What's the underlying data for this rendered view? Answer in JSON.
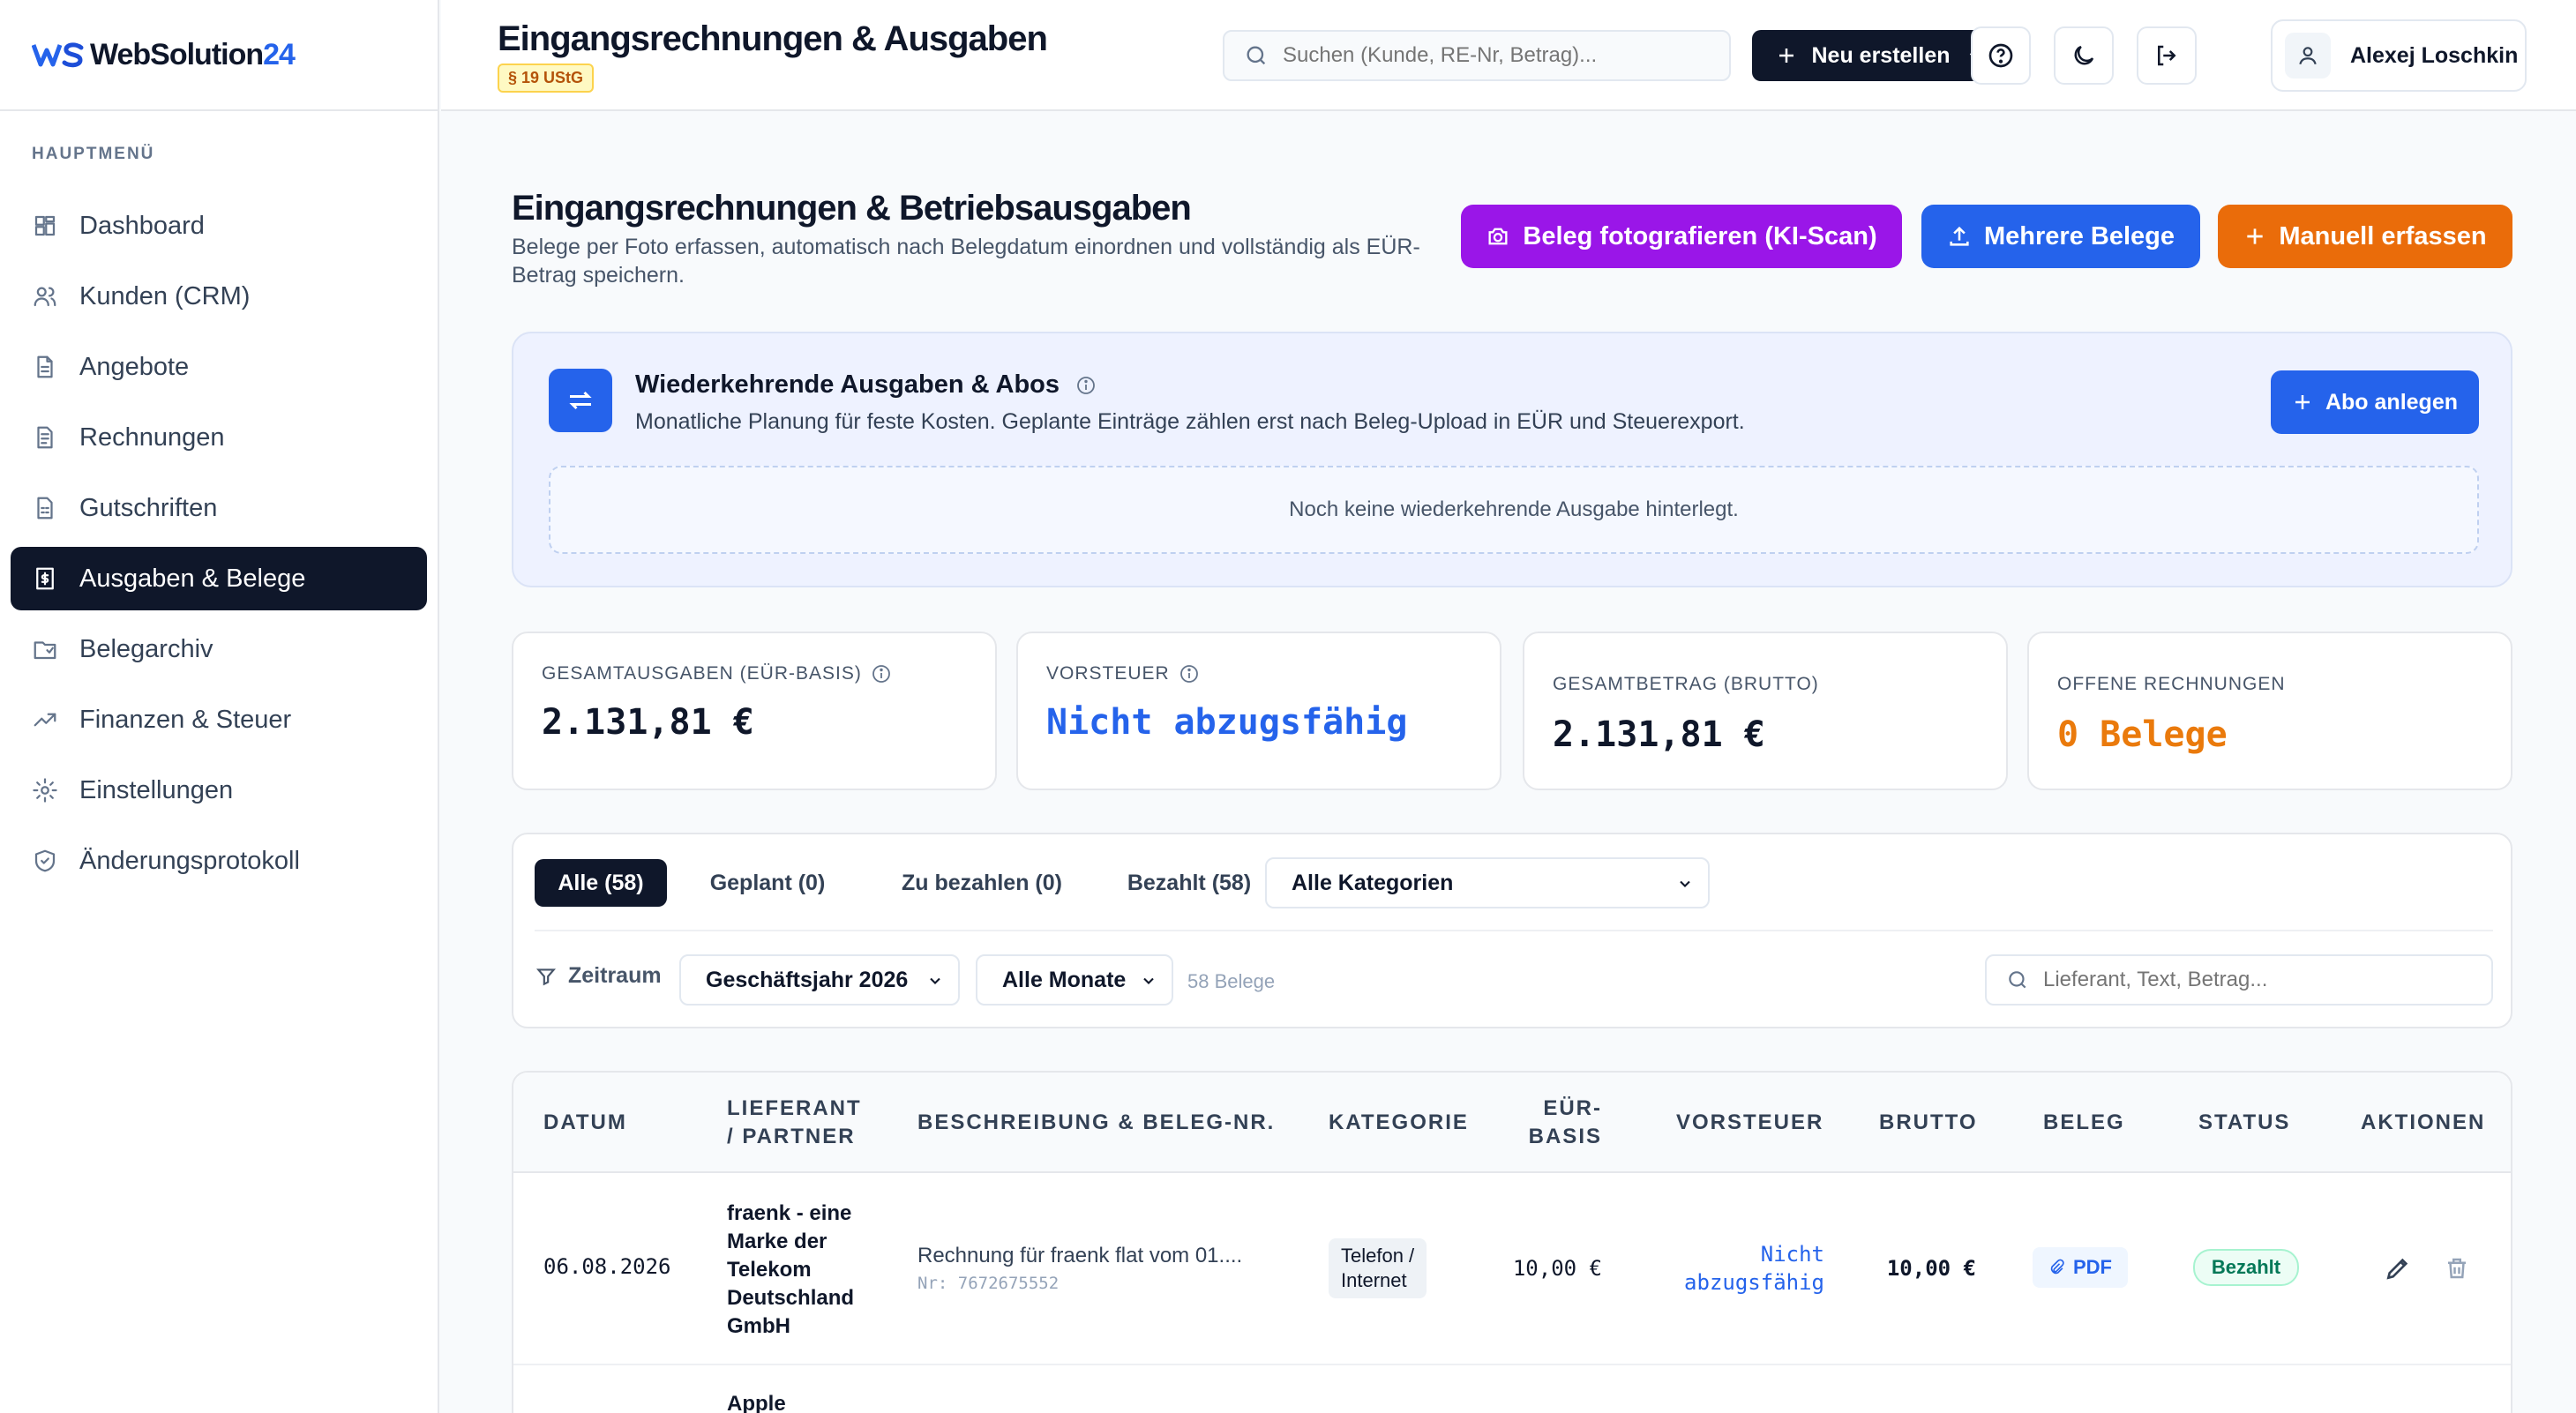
{
  "brand": {
    "logo_text": "WebSolution",
    "logo_num": "24"
  },
  "sidebar": {
    "heading": "HAUPTMENÜ",
    "items": [
      {
        "label": "Dashboard",
        "icon": "dashboard-icon"
      },
      {
        "label": "Kunden (CRM)",
        "icon": "users-icon"
      },
      {
        "label": "Angebote",
        "icon": "document-icon"
      },
      {
        "label": "Rechnungen",
        "icon": "invoice-icon"
      },
      {
        "label": "Gutschriften",
        "icon": "credit-note-icon"
      },
      {
        "label": "Ausgaben & Belege",
        "icon": "receipt-icon",
        "active": true
      },
      {
        "label": "Belegarchiv",
        "icon": "archive-icon"
      },
      {
        "label": "Finanzen & Steuer",
        "icon": "trending-up-icon"
      },
      {
        "label": "Einstellungen",
        "icon": "gear-icon"
      },
      {
        "label": "Änderungsprotokoll",
        "icon": "shield-icon"
      }
    ]
  },
  "header": {
    "title": "Eingangsrechnungen & Ausgaben",
    "badge": "§ 19 UStG",
    "search_placeholder": "Suchen (Kunde, RE-Nr, Betrag)...",
    "new_button": "Neu erstellen",
    "user_name": "Alexej Loschkin"
  },
  "main": {
    "title": "Eingangsrechnungen & Betriebsausgaben",
    "subtitle": "Belege per Foto erfassen, automatisch nach Belegdatum einordnen und vollständig als EÜR-Betrag speichern.",
    "btn_scan": "Beleg fotografieren (KI-Scan)",
    "btn_multi": "Mehrere Belege",
    "btn_manual": "Manuell erfassen"
  },
  "abo": {
    "title": "Wiederkehrende Ausgaben & Abos",
    "description": "Monatliche Planung für feste Kosten. Geplante Einträge zählen erst nach Beleg-Upload in EÜR und Steuerexport.",
    "button": "Abo anlegen",
    "empty": "Noch keine wiederkehrende Ausgabe hinterlegt."
  },
  "stats": [
    {
      "label": "GESAMTAUSGABEN (EÜR-BASIS)",
      "value": "2.131,81 €",
      "color": "#0f172a"
    },
    {
      "label": "VORSTEUER",
      "value": "Nicht abzugsfähig",
      "color": "#2563eb"
    },
    {
      "label": "GESAMTBETRAG (BRUTTO)",
      "value": "2.131,81 €",
      "color": "#0f172a"
    },
    {
      "label": "OFFENE RECHNUNGEN",
      "value": "0 Belege",
      "color": "#ea7a0c"
    }
  ],
  "filters": {
    "tabs": [
      "Alle (58)",
      "Geplant (0)",
      "Zu bezahlen (0)",
      "Bezahlt (58)"
    ],
    "category": "Alle Kategorien",
    "zeitraum_label": "Zeitraum",
    "year": "Geschäftsjahr 2026",
    "month": "Alle Monate",
    "count": "58 Belege",
    "search_placeholder": "Lieferant, Text, Betrag..."
  },
  "table": {
    "columns": {
      "datum": "DATUM",
      "lieferant": [
        "LIEFERANT",
        "/ PARTNER"
      ],
      "beschreibung": "BESCHREIBUNG & BELEG-NR.",
      "kategorie": "KATEGORIE",
      "eur": [
        "EÜR-",
        "BASIS"
      ],
      "vorsteuer": "VORSTEUER",
      "brutto": "BRUTTO",
      "beleg": "BELEG",
      "status": "STATUS",
      "aktionen": "AKTIONEN"
    },
    "rows": [
      {
        "datum": "06.08.2026",
        "lieferant": [
          "fraenk - eine",
          "Marke der",
          "Telekom",
          "Deutschland",
          "GmbH"
        ],
        "beschreibung": "Rechnung für fraenk flat vom 01....",
        "nr": "Nr: 7672675552",
        "kategorie": [
          "Telefon /",
          "Internet"
        ],
        "eur": "10,00 €",
        "vorsteuer": [
          "Nicht",
          "abzugsfähig"
        ],
        "brutto": "10,00 €",
        "beleg": "PDF",
        "status": "Bezahlt"
      }
    ],
    "next_row_lieferant": "Apple"
  }
}
